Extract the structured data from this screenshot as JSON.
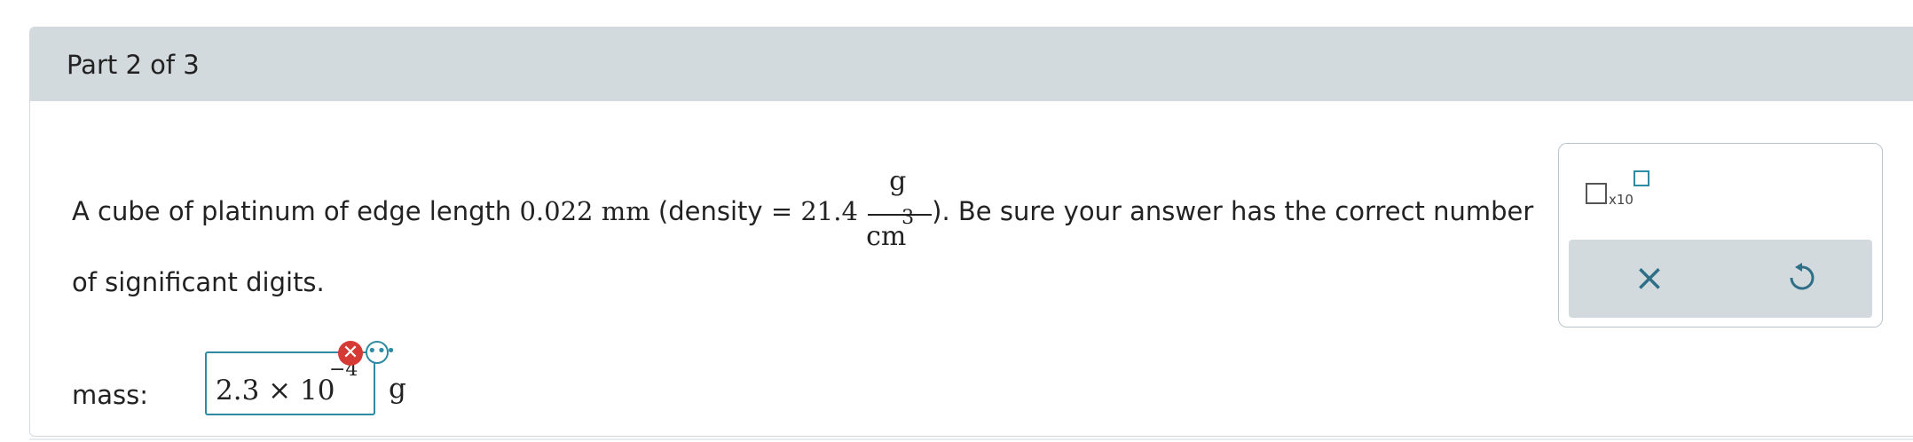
{
  "part": {
    "title": "Part 2 of 3"
  },
  "question": {
    "intro": "A cube of platinum of edge length ",
    "edge_value": "0.022",
    "edge_unit": "mm",
    "density_open": " (density ",
    "equals": "= 21.4",
    "fraction_numerator": "g",
    "fraction_denominator": "cm",
    "fraction_exponent": "3",
    "after_fraction": "). Be sure your answer has the correct number",
    "line2": "of significant digits."
  },
  "answer": {
    "label": "mass:",
    "value_text": "2.3 × 10",
    "exponent": "−4",
    "unit": "g",
    "error_icon": "close-circle-icon",
    "more_icon": "ellipsis-icon"
  },
  "tools": {
    "x10_label": "x10",
    "clear_symbol": "×",
    "undo_icon": "undo-icon"
  }
}
